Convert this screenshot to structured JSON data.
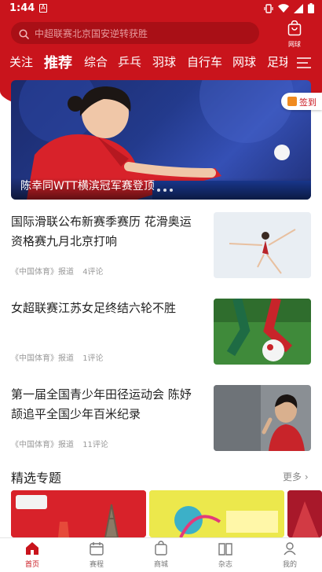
{
  "status": {
    "time": "1:44"
  },
  "header": {
    "search_placeholder": "中超联赛北京国安逆转获胜",
    "shop_label": "网球"
  },
  "tabs": [
    "关注",
    "推荐",
    "综合",
    "乒乓",
    "羽球",
    "自行车",
    "网球",
    "足球"
  ],
  "banner": {
    "caption": "陈幸同WTT横滨冠军赛登顶",
    "checkin": "签到"
  },
  "news": [
    {
      "title": "国际滑联公布新赛季赛历 花滑奥运资格赛九月北京打响",
      "source": "《中国体育》报道",
      "comments": "4评论"
    },
    {
      "title": "女超联赛江苏女足终结六轮不胜",
      "source": "《中国体育》报道",
      "comments": "1评论"
    },
    {
      "title": "第一届全国青少年田径运动会 陈妤颉追平全国少年百米纪录",
      "source": "《中国体育》报道",
      "comments": "11评论"
    }
  ],
  "topics": {
    "title": "精选专题",
    "more": "更多"
  },
  "bottom_nav": [
    {
      "label": "首页"
    },
    {
      "label": "赛程"
    },
    {
      "label": "商城"
    },
    {
      "label": "杂志"
    },
    {
      "label": "我的"
    }
  ],
  "colors": {
    "brand": "#c9141c"
  }
}
